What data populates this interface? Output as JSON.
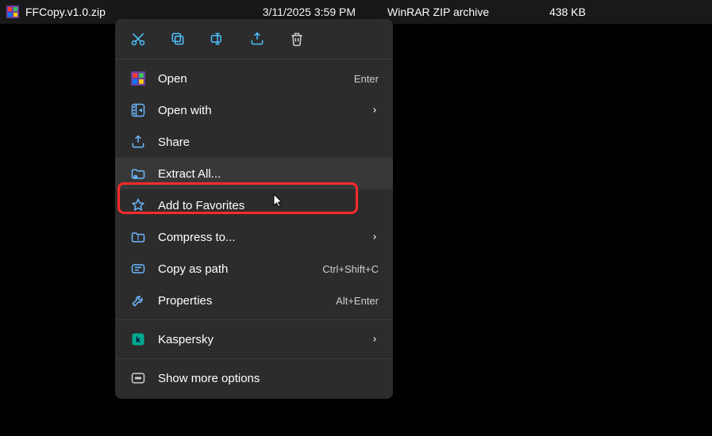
{
  "file": {
    "name": "FFCopy.v1.0.zip",
    "date": "3/11/2025 3:59 PM",
    "type": "WinRAR ZIP archive",
    "size": "438 KB"
  },
  "icon_row": {
    "cut": "cut-icon",
    "copy": "copy-icon",
    "rename": "rename-icon",
    "share": "share-icon",
    "delete": "delete-icon"
  },
  "menu": {
    "open": {
      "label": "Open",
      "shortcut": "Enter"
    },
    "open_with": {
      "label": "Open with"
    },
    "share": {
      "label": "Share"
    },
    "extract_all": {
      "label": "Extract All..."
    },
    "add_favorites": {
      "label": "Add to Favorites"
    },
    "compress_to": {
      "label": "Compress to..."
    },
    "copy_path": {
      "label": "Copy as path",
      "shortcut": "Ctrl+Shift+C"
    },
    "properties": {
      "label": "Properties",
      "shortcut": "Alt+Enter"
    },
    "kaspersky": {
      "label": "Kaspersky"
    },
    "show_more": {
      "label": "Show more options"
    }
  }
}
